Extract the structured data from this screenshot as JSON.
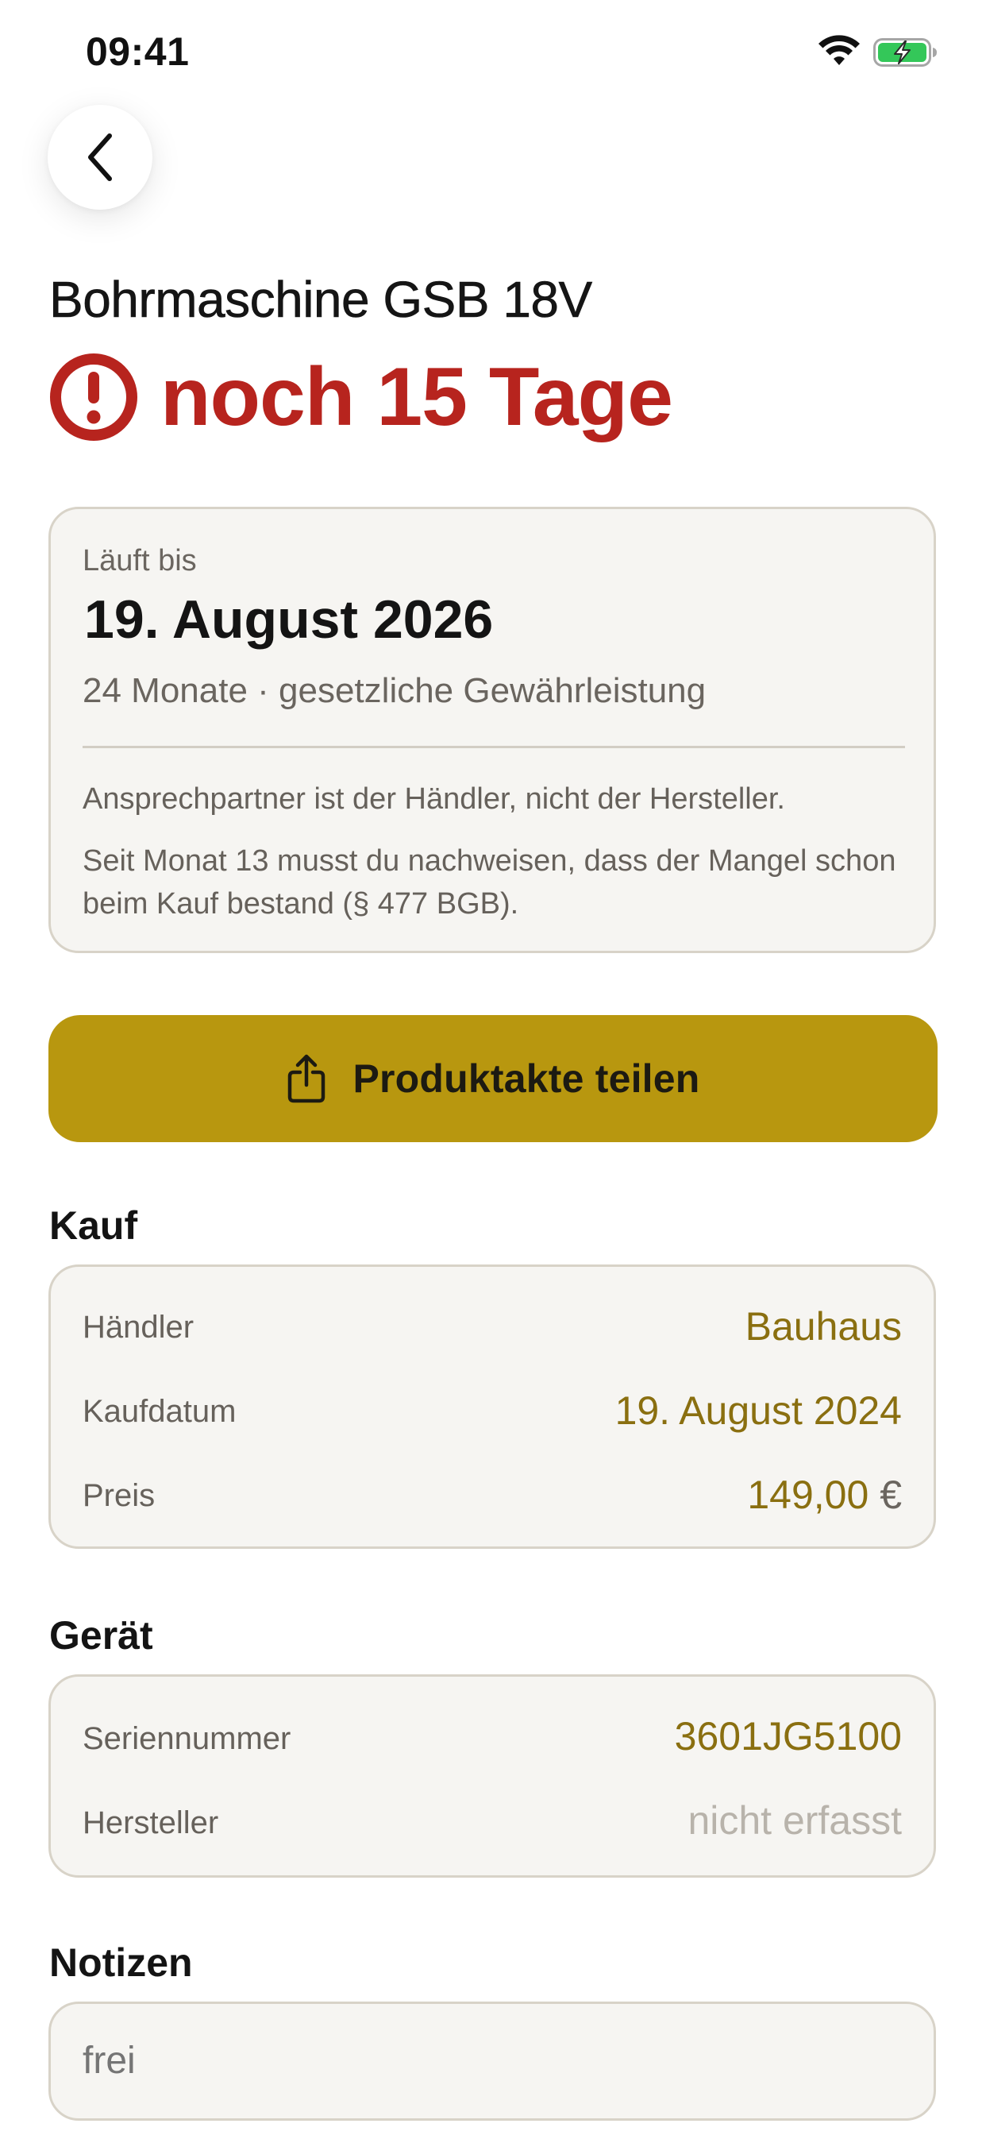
{
  "status_bar": {
    "time": "09:41",
    "icons": [
      "wifi-icon",
      "battery-charging-icon"
    ],
    "battery_color": "#34c759"
  },
  "nav": {
    "back_icon": "chevron-left-icon"
  },
  "product": {
    "title": "Bohrmaschine GSB 18V",
    "countdown": "noch 15 Tage",
    "alert_icon": "exclamation-circle-icon",
    "alert_color": "#b7241e"
  },
  "warranty": {
    "label": "Läuft bis",
    "end_date": "19. August 2026",
    "duration_type": "24 Monate · gesetzliche Gewährleistung",
    "note_contact": "Ansprechpartner ist der Händler, nicht der Hersteller.",
    "note_burden": "Seit Monat 13 musst du nachweisen, dass der Mangel schon beim Kauf bestand (§ 477 BGB)."
  },
  "share": {
    "label": "Produktakte teilen",
    "icon": "share-icon",
    "color": "#b8970f"
  },
  "purchase": {
    "title": "Kauf",
    "rows": [
      {
        "label": "Händler",
        "value": "Bauhaus"
      },
      {
        "label": "Kaufdatum",
        "value": "19. August 2024"
      },
      {
        "label": "Preis",
        "amount": "149,00",
        "currency": "€"
      }
    ]
  },
  "device": {
    "title": "Gerät",
    "rows": [
      {
        "label": "Seriennummer",
        "value": "3601JG5100"
      },
      {
        "label": "Hersteller",
        "placeholder": "nicht erfasst"
      }
    ]
  },
  "notes": {
    "title": "Notizen",
    "value": "",
    "placeholder": "frei"
  },
  "colors": {
    "accent": "#8a6f10",
    "card_bg": "#f6f5f2",
    "card_border": "#d8d3c8"
  }
}
